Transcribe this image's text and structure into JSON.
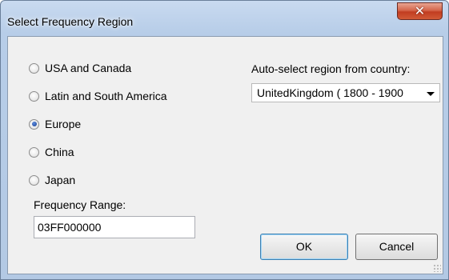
{
  "window": {
    "title": "Select Frequency Region",
    "close_glyph": "✕",
    "close_icon": "close-icon"
  },
  "regions": [
    {
      "label": "USA and Canada",
      "checked": false
    },
    {
      "label": "Latin and South America",
      "checked": false
    },
    {
      "label": "Europe",
      "checked": true
    },
    {
      "label": "China",
      "checked": false
    },
    {
      "label": "Japan",
      "checked": false
    }
  ],
  "frequency": {
    "label": "Frequency Range:",
    "value": "03FF000000"
  },
  "auto_select": {
    "label": "Auto-select region from country:",
    "selected": "UnitedKingdom ( 1800 - 1900",
    "arrow_icon": "chevron-down-icon"
  },
  "buttons": {
    "ok": "OK",
    "cancel": "Cancel"
  },
  "colors": {
    "close_red": "#c13d21",
    "title_bar": "#b9cfea",
    "client_bg": "#f0f0f0",
    "radio_dot": "#1c3f8c"
  }
}
